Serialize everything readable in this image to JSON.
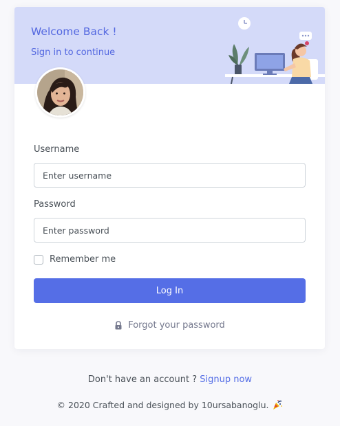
{
  "hero": {
    "title": "Welcome Back !",
    "subtitle": "Sign in to continue"
  },
  "form": {
    "username_label": "Username",
    "username_placeholder": "Enter username",
    "password_label": "Password",
    "password_placeholder": "Enter password",
    "remember_label": "Remember me",
    "remember_checked": false,
    "login_label": "Log In",
    "forgot_label": "Forgot your password",
    "forgot_icon": "lock-icon"
  },
  "footer": {
    "signup_prompt": "Don't have an account ?",
    "signup_link": "Signup now",
    "copyright": "© 2020 Crafted and designed by 10ursabanoglu.",
    "copyright_icon": "party-popper-icon"
  },
  "colors": {
    "primary": "#556ee6",
    "hero_bg": "#d4daf9",
    "page_bg": "#f8f8fb",
    "text": "#495057",
    "muted": "#74788d"
  }
}
